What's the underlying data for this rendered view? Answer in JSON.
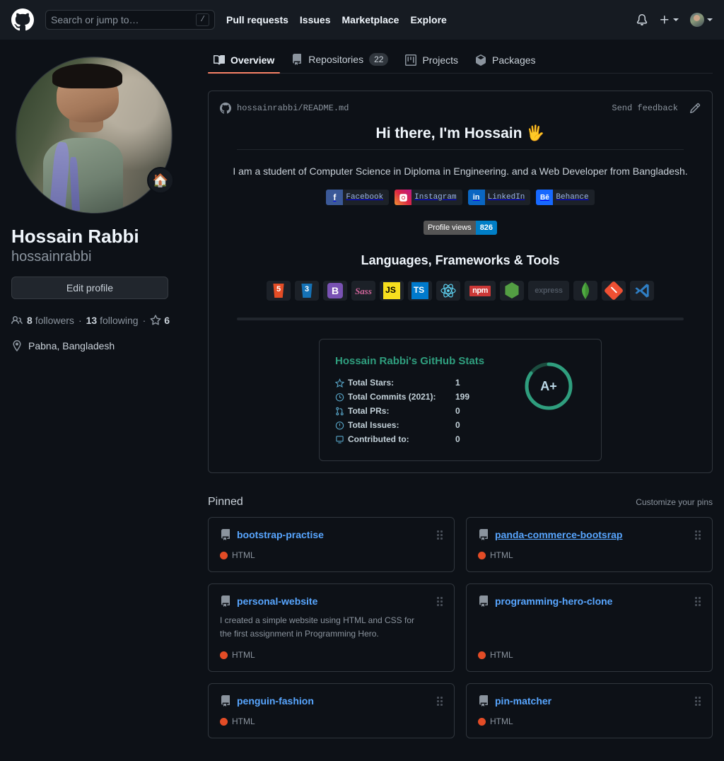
{
  "header": {
    "logo_icon": "github-mark-icon",
    "search": {
      "placeholder": "Search or jump to…",
      "value": "",
      "shortcut": "/"
    },
    "nav": [
      {
        "label": "Pull requests"
      },
      {
        "label": "Issues"
      },
      {
        "label": "Marketplace"
      },
      {
        "label": "Explore"
      }
    ],
    "notifications_icon": "bell-icon",
    "create_new_icon": "plus-icon",
    "account_icon": "avatar-icon"
  },
  "tabs": [
    {
      "label": "Overview",
      "icon": "book-icon",
      "active": true,
      "badge": ""
    },
    {
      "label": "Repositories",
      "icon": "repo-icon",
      "active": false,
      "badge": "22"
    },
    {
      "label": "Projects",
      "icon": "project-icon",
      "active": false,
      "badge": ""
    },
    {
      "label": "Packages",
      "icon": "package-icon",
      "active": false,
      "badge": ""
    }
  ],
  "profile": {
    "name": "Hossain Rabbi",
    "login": "hossainrabbi",
    "edit_button": "Edit profile",
    "followers_count": "8",
    "followers_label": "followers",
    "following_count": "13",
    "following_label": "following",
    "stars_count": "6",
    "location": "Pabna, Bangladesh",
    "status_emoji": "🏠"
  },
  "readme": {
    "owner": "hossainrabbi",
    "separator": "/",
    "file": "README.md",
    "send_feedback": "Send feedback",
    "edit_icon": "pencil-icon",
    "title": "Hi there, I'm Hossain",
    "title_emoji": "🖐",
    "intro": "I am a student of Computer Science in Diploma in Engineering. and a Web Developer from Bangladesh.",
    "socials": [
      {
        "label": "Facebook",
        "icon": "facebook-icon",
        "glyph": "f"
      },
      {
        "label": "Instagram",
        "icon": "instagram-icon",
        "glyph": "◙"
      },
      {
        "label": "LinkedIn",
        "icon": "linkedin-icon",
        "glyph": "in"
      },
      {
        "label": "Behance",
        "icon": "behance-icon",
        "glyph": "Bē"
      }
    ],
    "profile_views": {
      "label": "Profile views",
      "count": "826"
    },
    "tech_title": "Languages, Frameworks & Tools",
    "tech": [
      {
        "name": "HTML5",
        "icon": "html5-icon",
        "glyph": "5"
      },
      {
        "name": "CSS3",
        "icon": "css3-icon",
        "glyph": "3"
      },
      {
        "name": "Bootstrap",
        "icon": "bootstrap-icon",
        "glyph": "B"
      },
      {
        "name": "Sass",
        "icon": "sass-icon",
        "glyph": "Sass"
      },
      {
        "name": "JavaScript",
        "icon": "javascript-icon",
        "glyph": "JS"
      },
      {
        "name": "TypeScript",
        "icon": "typescript-icon",
        "glyph": "TS"
      },
      {
        "name": "React",
        "icon": "react-icon",
        "glyph": ""
      },
      {
        "name": "npm",
        "icon": "npm-icon",
        "glyph": "npm"
      },
      {
        "name": "Node.js",
        "icon": "nodejs-icon",
        "glyph": ""
      },
      {
        "name": "Express",
        "icon": "express-icon",
        "glyph": "express"
      },
      {
        "name": "MongoDB",
        "icon": "mongodb-icon",
        "glyph": ""
      },
      {
        "name": "Git",
        "icon": "git-icon",
        "glyph": ""
      },
      {
        "name": "VS Code",
        "icon": "vscode-icon",
        "glyph": ""
      }
    ]
  },
  "stats_card": {
    "title": "Hossain Rabbi's GitHub Stats",
    "rows": [
      {
        "icon": "star-icon",
        "label": "Total Stars:",
        "value": "1"
      },
      {
        "icon": "clock-icon",
        "label": "Total Commits (2021):",
        "value": "199"
      },
      {
        "icon": "pr-icon",
        "label": "Total PRs:",
        "value": "0"
      },
      {
        "icon": "issue-icon",
        "label": "Total Issues:",
        "value": "0"
      },
      {
        "icon": "repo-icon",
        "label": "Contributed to:",
        "value": "0"
      }
    ],
    "rank": "A+",
    "rank_percent": 85,
    "accent_color": "#2f9e7e",
    "track_color": "#1b4d3f",
    "text_color": "#c3d1d9"
  },
  "pinned": {
    "title": "Pinned",
    "customize_label": "Customize your pins",
    "repos": [
      {
        "name": "bootstrap-practise",
        "description": "",
        "language": "HTML",
        "lang_color": "#e34c26",
        "hover": false
      },
      {
        "name": "panda-commerce-bootsrap",
        "description": "",
        "language": "HTML",
        "lang_color": "#e34c26",
        "hover": true
      },
      {
        "name": "personal-website",
        "description": "I created a simple website using HTML and CSS for the first assignment in Programming Hero.",
        "language": "HTML",
        "lang_color": "#e34c26",
        "hover": false
      },
      {
        "name": "programming-hero-clone",
        "description": "",
        "language": "HTML",
        "lang_color": "#e34c26",
        "hover": false
      },
      {
        "name": "penguin-fashion",
        "description": "",
        "language": "HTML",
        "lang_color": "#e34c26",
        "hover": false
      },
      {
        "name": "pin-matcher",
        "description": "",
        "language": "HTML",
        "lang_color": "#e34c26",
        "hover": false
      }
    ]
  },
  "theme": {
    "bg": "#0d1117",
    "header_bg": "#161b22",
    "border": "#30363d",
    "text": "#c9d1d9",
    "muted": "#8b949e",
    "link": "#58a6ff",
    "active_tab": "#f78166"
  }
}
